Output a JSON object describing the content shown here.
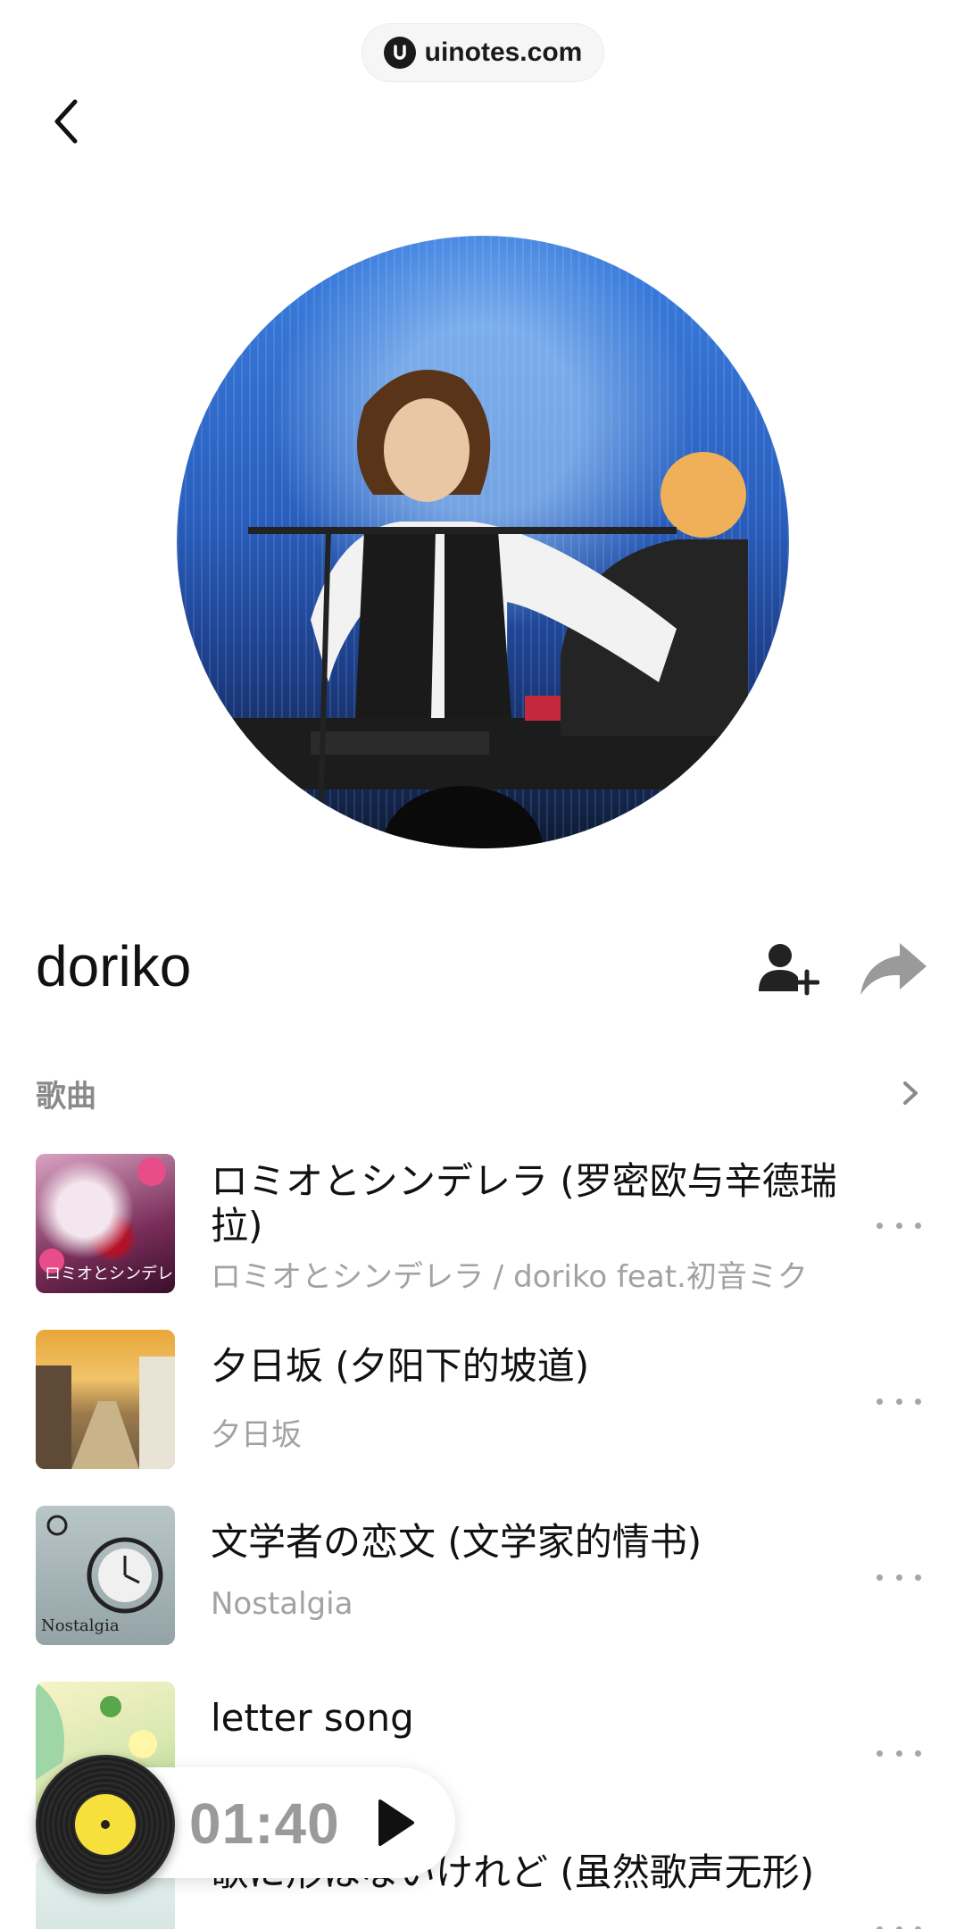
{
  "watermark": {
    "text": "uinotes.com"
  },
  "artist": {
    "name": "doriko"
  },
  "section": {
    "title": "歌曲"
  },
  "songs": [
    {
      "title": "ロミオとシンデレラ (罗密欧与辛德瑞拉)",
      "subtitle": "ロミオとシンデレラ / doriko feat.初音ミク"
    },
    {
      "title": "夕日坂 (夕阳下的坡道)",
      "subtitle": "夕日坂"
    },
    {
      "title": "文学者の恋文 (文学家的情书)",
      "subtitle": "Nostalgia"
    },
    {
      "title": "letter song",
      "subtitle": ""
    },
    {
      "title": "歌に形はないけれど (虽然歌声无形)",
      "subtitle": ""
    }
  ],
  "cover_text": {
    "song0": "ロミオとシンデレラ",
    "song2": "Nostalgia"
  },
  "player": {
    "time": "01:40"
  },
  "colors": {
    "accent_vinyl": "#f7e03c",
    "subtitle_gray": "#a2a2a2"
  }
}
